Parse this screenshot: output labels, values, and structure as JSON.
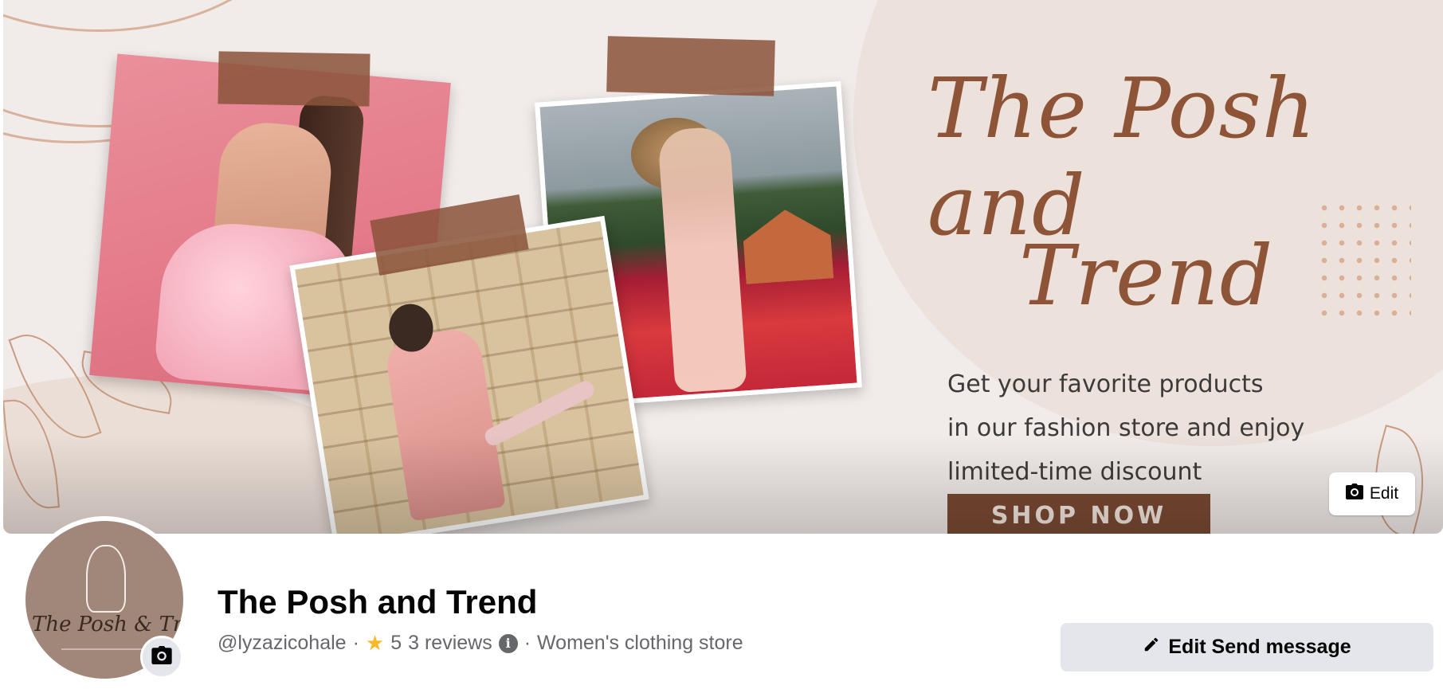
{
  "cover": {
    "headline_line1": "The Posh and",
    "headline_line2": "Trend",
    "tagline": [
      "Get your favorite products",
      "in our fashion store and enjoy",
      "limited-time discount"
    ],
    "cta_label": "SHOP NOW",
    "edit_label": "Edit"
  },
  "avatar": {
    "logo_text": "The Posh & Trend",
    "camera_icon": "camera-icon"
  },
  "page": {
    "name": "The Posh and Trend",
    "username": "@lyzazicohale",
    "separator": "·",
    "rating": "5",
    "reviews": "3 reviews",
    "category": "Women's clothing store"
  },
  "actions": {
    "edit_send_label": "Edit Send message",
    "edit_send_icon": "pencil-icon"
  },
  "colors": {
    "brand_brown": "#8e5437",
    "button_gray": "#e4e6eb",
    "star": "#f7b928",
    "secondary_text": "#65676b"
  }
}
